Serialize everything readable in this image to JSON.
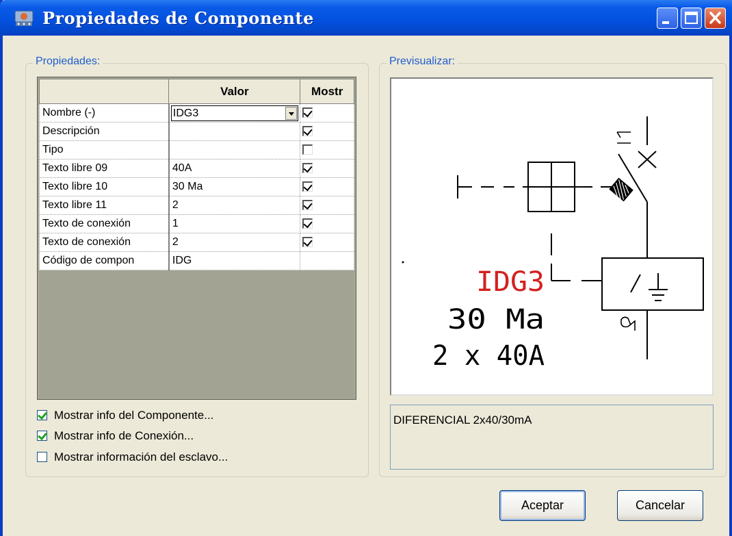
{
  "window": {
    "title": "Propiedades de Componente"
  },
  "properties": {
    "group_label": "Propiedades:",
    "headers": [
      "",
      "Valor",
      "Mostr"
    ],
    "rows": [
      {
        "name": "Nombre (-)",
        "value": "IDG3",
        "show": true,
        "dropdown": true
      },
      {
        "name": "Descripción",
        "value": "",
        "show": true
      },
      {
        "name": "Tipo",
        "value": "",
        "show": false
      },
      {
        "name": "Texto libre 09",
        "value": "40A",
        "show": true
      },
      {
        "name": "Texto libre 10",
        "value": "30 Ma",
        "show": true
      },
      {
        "name": "Texto libre 11",
        "value": "2",
        "show": true
      },
      {
        "name": "Texto de conexión",
        "value": "1",
        "show": true
      },
      {
        "name": "Texto de conexión",
        "value": "2",
        "show": true
      },
      {
        "name": "Código de compon",
        "value": "IDG",
        "show": null
      }
    ]
  },
  "options": [
    {
      "label": "Mostrar info del Componente...",
      "checked": true
    },
    {
      "label": "Mostrar info de Conexión...",
      "checked": true
    },
    {
      "label": "Mostrar información del esclavo...",
      "checked": false
    }
  ],
  "preview": {
    "group_label": "Previsualizar:",
    "symbol_text": {
      "name": "IDG3",
      "line2": "30 Ma",
      "line3": "2 x 40A",
      "pin1": "1",
      "pin2": "2"
    },
    "description": "DIFERENCIAL 2x40/30mA"
  },
  "buttons": {
    "accept": "Aceptar",
    "cancel": "Cancelar"
  },
  "colors": {
    "titlebar": "#0350de",
    "symbol_name": "#d42020"
  },
  "icons": [
    "app-icon",
    "minimize-icon",
    "maximize-icon",
    "close-icon"
  ]
}
